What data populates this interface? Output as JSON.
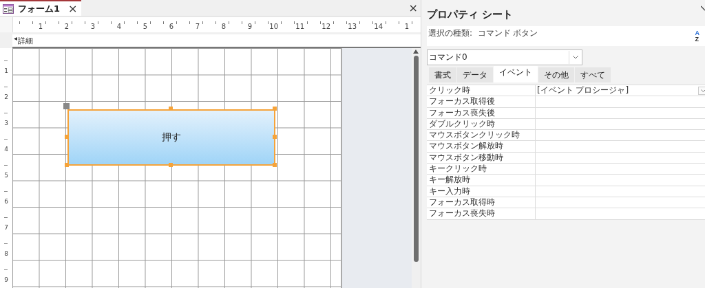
{
  "document_tab": {
    "title": "フォーム1",
    "close": "×",
    "selected": true
  },
  "pane_close": "×",
  "ruler": {
    "labels": [
      "1",
      "2",
      "3",
      "4",
      "5",
      "6",
      "7",
      "8",
      "9",
      "10",
      "11",
      "12",
      "13",
      "14",
      "1"
    ]
  },
  "vertical_ruler": {
    "labels": [
      "1",
      "2",
      "3",
      "4",
      "5",
      "6",
      "7",
      "8",
      "9"
    ]
  },
  "section": {
    "label": "詳細"
  },
  "form": {
    "button": {
      "label": "押す",
      "selected": true
    }
  },
  "property_sheet": {
    "title": "プロパティ シート",
    "selection_type": "選択の種類:  コマンド ボタン",
    "object": "コマンド0",
    "tabs": [
      {
        "label": "書式",
        "selected": false
      },
      {
        "label": "データ",
        "selected": false
      },
      {
        "label": "イベント",
        "selected": true
      },
      {
        "label": "その他",
        "selected": false
      },
      {
        "label": "すべて",
        "selected": false
      }
    ],
    "sort_icon": {
      "top": "A",
      "bottom": "Z"
    },
    "properties": [
      {
        "name": "クリック時",
        "value": "[イベント プロシージャ]"
      },
      {
        "name": "フォーカス取得後"
      },
      {
        "name": "フォーカス喪失後"
      },
      {
        "name": "ダブルクリック時"
      },
      {
        "name": "マウスボタンクリック時"
      },
      {
        "name": "マウスボタン解放時"
      },
      {
        "name": "マウスボタン移動時"
      },
      {
        "name": "キークリック時"
      },
      {
        "name": "キー解放時"
      },
      {
        "name": "キー入力時"
      },
      {
        "name": "フォーカス取得時"
      },
      {
        "name": "フォーカス喪失時"
      }
    ]
  }
}
